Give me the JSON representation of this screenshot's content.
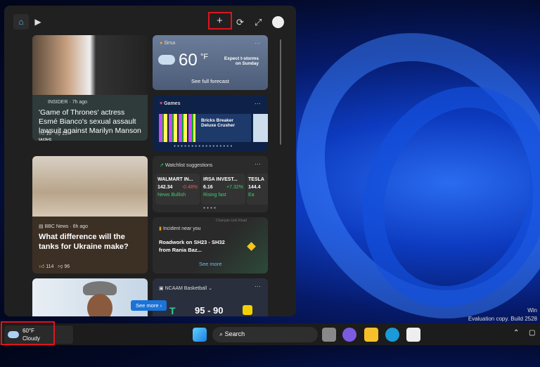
{
  "desktop": {
    "watermark_line1": "Win",
    "watermark_line2": "Evaluation copy. Build 2528"
  },
  "panel": {
    "header": {
      "home_tab": "home-icon",
      "video_tab": "video-icon",
      "add_widget": "+",
      "refresh": "⟳",
      "expand": "⤢"
    },
    "cards": {
      "got": {
        "source": "INSIDER · 7h ago",
        "title": "'Game of Thrones' actress Esmé Bianco's sexual assault lawsuit against Marilyn Manson was...",
        "likes": "16",
        "dislikes": "15"
      },
      "weather": {
        "location": "Sirsa",
        "temp": "60",
        "unit": "°F",
        "forecast": "Expect t-storms on Sunday",
        "link": "See full forecast"
      },
      "games": {
        "label": "Games",
        "game": "Bricks Breaker Deluxe Crusher"
      },
      "tanks": {
        "source": "BBC News · 6h ago",
        "title": "What difference will the tanks for Ukraine make?",
        "likes": "114",
        "dislikes": "96"
      },
      "watchlist": {
        "label": "Watchlist suggestions",
        "stocks": [
          {
            "name": "WALMART IN...",
            "price": "142.34",
            "change": "-0.48%",
            "tag": "News Bullish",
            "color": "#e06060"
          },
          {
            "name": "IRSA INVEST...",
            "price": "6.16",
            "change": "+7.32%",
            "tag": "Rising fast",
            "color": "#3ccf6e"
          },
          {
            "name": "TESLA",
            "price": "144.4",
            "change": "",
            "tag": "Ea",
            "color": "#3ccf6e"
          }
        ]
      },
      "incident": {
        "label": "Incident near you",
        "title": "Roadwork on SH23 - SH32 from Rania Baz...",
        "link": "See more",
        "road": "Chariyan Link Road"
      },
      "basketball": {
        "label": "NCAAM Basketball",
        "score_home": "95",
        "score_away": "90"
      },
      "see_more": "See more"
    }
  },
  "taskbar": {
    "weather_temp": "60°F",
    "weather_desc": "Cloudy",
    "search": "Search"
  }
}
